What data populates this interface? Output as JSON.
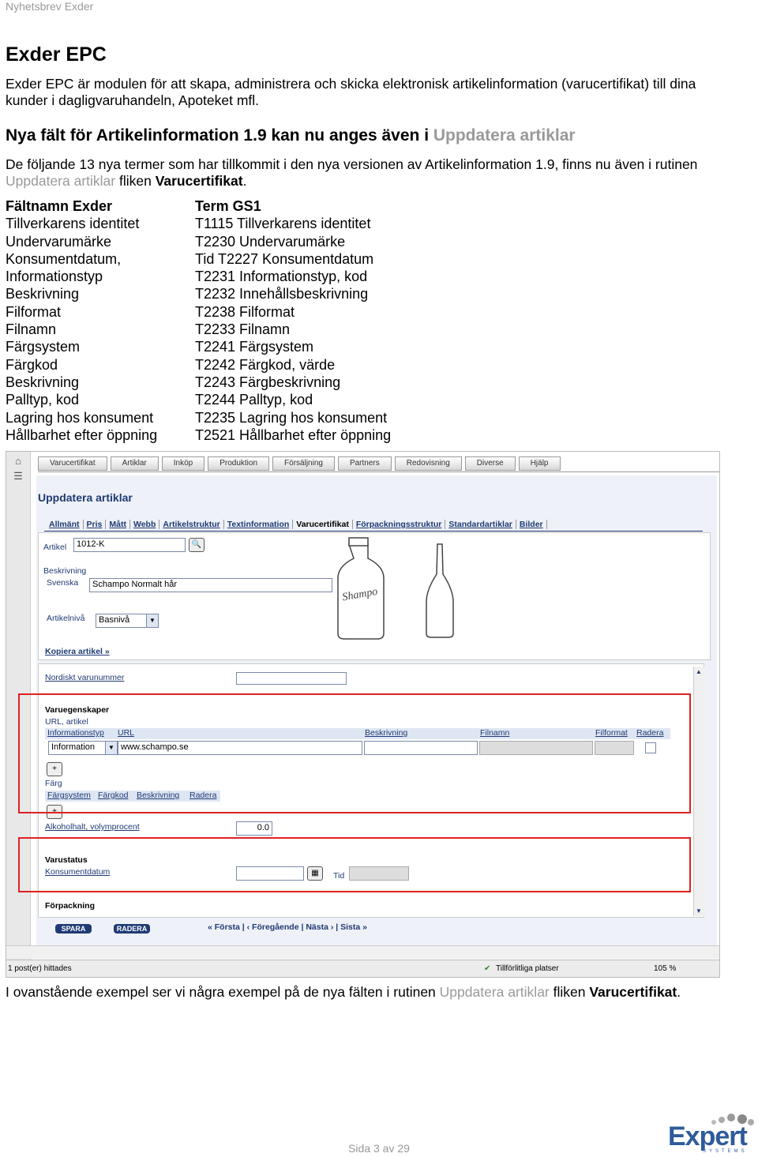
{
  "header": "Nyhetsbrev Exder",
  "title": "Exder EPC",
  "intro": "Exder EPC är modulen för att skapa, administrera och skicka elektronisk artikelinformation (varucertifikat) till dina kunder i dagligvaruhandeln, Apoteket mfl.",
  "subheading": {
    "prefix": "Nya fält för Artikelinformation 1.9 kan nu anges även i ",
    "link": "Uppdatera artiklar"
  },
  "para": {
    "part1": "De följande 13 nya termer som har tillkommit i den nya versionen av Artikelinformation 1.9, finns nu även i rutinen ",
    "link": "Uppdatera artiklar",
    "part2": " fliken ",
    "bold": "Varucertifikat",
    "end": "."
  },
  "table": {
    "col1_header": "Fältnamn Exder",
    "col2_header": "Term GS1",
    "col1": [
      "Tillverkarens identitet",
      "Undervarumärke",
      "Konsumentdatum,",
      "Informationstyp",
      "Beskrivning",
      "Filformat",
      "Filnamn",
      "Färgsystem",
      "Färgkod",
      "Beskrivning",
      "Palltyp, kod",
      "Lagring hos konsument",
      "Hållbarhet efter öppning"
    ],
    "col2": [
      "T1115 Tillverkarens identitet",
      "T2230 Undervarumärke",
      "Tid T2227 Konsumentdatum",
      "T2231 Informationstyp, kod",
      "T2232 Innehållsbeskrivning",
      "T2238 Filformat",
      "T2233 Filnamn",
      "T2241 Färgsystem",
      "T2242 Färgkod, värde",
      "T2243 Färgbeskrivning",
      "T2244 Palltyp, kod",
      "T2235 Lagring hos konsument",
      "T2521 Hållbarhet efter öppning"
    ]
  },
  "screenshot": {
    "topnav": [
      "Varucertifikat",
      "Artiklar",
      "Inköp",
      "Produktion",
      "Försäljning",
      "Partners",
      "Redovisning",
      "Diverse",
      "Hjälp"
    ],
    "page_title": "Uppdatera artiklar",
    "tabs": [
      "Allmänt",
      "Pris",
      "Mått",
      "Webb",
      "Artikelstruktur",
      "Textinformation",
      "Varucertifikat",
      "Förpackningsstruktur",
      "Standardartiklar",
      "Bilder"
    ],
    "artikel_label": "Artikel",
    "artikel_value": "1012-K",
    "beskrivning_label": "Beskrivning",
    "svenska_label": "Svenska",
    "svenska_value": "Schampo Normalt hår",
    "artikelniva_label": "Artikelnivå",
    "artikelniva_value": "Basnivå",
    "kopiera_link": "Kopiera artikel »",
    "nordiskt_label": "Nordiskt varunummer",
    "varuegenskaper": "Varuegenskaper",
    "url_artikel": "URL, artikel",
    "url_cols": [
      "Informationstyp",
      "URL",
      "Beskrivning",
      "Filnamn",
      "Filformat",
      "Radera"
    ],
    "informationstyp_value": "Information",
    "url_value": "www.schampo.se",
    "farg_label": "Färg",
    "farg_cols": [
      "Färgsystem",
      "Färgkod",
      "Beskrivning",
      "Radera"
    ],
    "alkohol_label": "Alkoholhalt, volymprocent",
    "alkohol_value": "0.0",
    "varustatus": "Varustatus",
    "konsumentdatum": "Konsumentdatum",
    "tid_label": "Tid",
    "forpackning": "Förpackning",
    "spara": "SPARA",
    "radera": "RADERA",
    "pager": "« Första | ‹ Föregående | Nästa › | Sista »",
    "status_left": "1 post(er) hittades",
    "status_zone": "Tillförlitliga platser",
    "status_zoom": "105 %"
  },
  "caption": {
    "part1": "I ovanstående exempel ser vi några exempel på de nya fälten i rutinen ",
    "link": "Uppdatera artiklar",
    "part2": " fliken ",
    "bold": "Varucertifikat",
    "end": "."
  },
  "footer": "Sida 3 av 29",
  "logo": {
    "word": "Expert",
    "sub": "SYSTEMS"
  }
}
